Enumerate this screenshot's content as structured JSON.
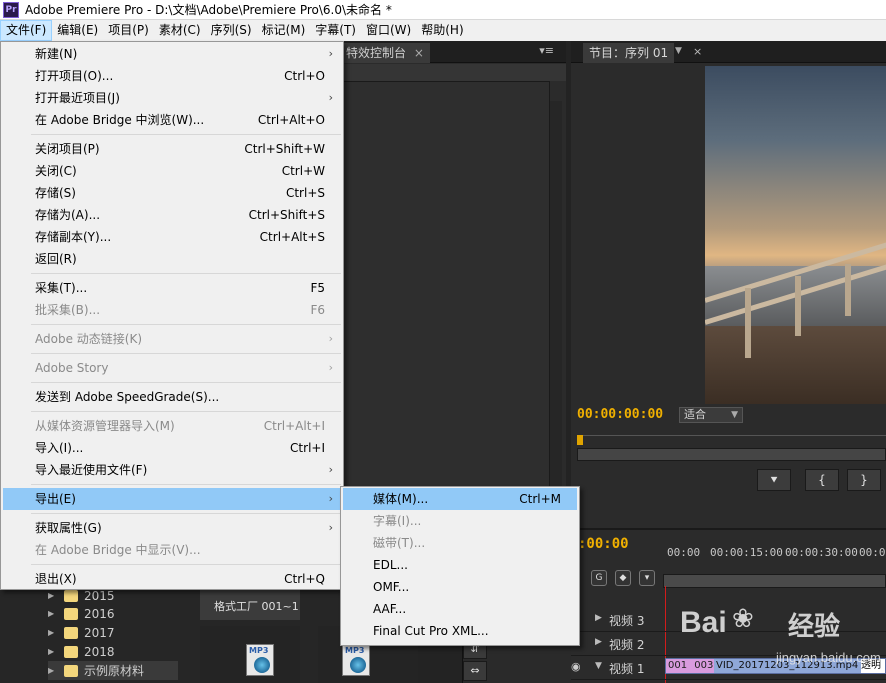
{
  "window": {
    "icon_text": "Pr",
    "title": "Adobe Premiere Pro - D:\\文档\\Adobe\\Premiere Pro\\6.0\\未命名 *"
  },
  "menubar": [
    {
      "label": "文件(F)",
      "active": true
    },
    {
      "label": "编辑(E)"
    },
    {
      "label": "项目(P)"
    },
    {
      "label": "素材(C)"
    },
    {
      "label": "序列(S)"
    },
    {
      "label": "标记(M)"
    },
    {
      "label": "字幕(T)"
    },
    {
      "label": "窗口(W)"
    },
    {
      "label": "帮助(H)"
    }
  ],
  "file_menu": {
    "items": [
      {
        "label": "新建(N)",
        "submenu": true
      },
      {
        "label": "打开项目(O)...",
        "shortcut": "Ctrl+O"
      },
      {
        "label": "打开最近项目(J)",
        "submenu": true
      },
      {
        "label": "在 Adobe Bridge 中浏览(W)...",
        "shortcut": "Ctrl+Alt+O"
      },
      {
        "label": "关闭项目(P)",
        "shortcut": "Ctrl+Shift+W"
      },
      {
        "label": "关闭(C)",
        "shortcut": "Ctrl+W"
      },
      {
        "label": "存储(S)",
        "shortcut": "Ctrl+S"
      },
      {
        "label": "存储为(A)...",
        "shortcut": "Ctrl+Shift+S"
      },
      {
        "label": "存储副本(Y)...",
        "shortcut": "Ctrl+Alt+S"
      },
      {
        "label": "返回(R)"
      },
      {
        "label": "采集(T)...",
        "shortcut": "F5"
      },
      {
        "label": "批采集(B)...",
        "shortcut": "F6",
        "disabled": true
      },
      {
        "label": "Adobe 动态链接(K)",
        "submenu": true,
        "disabled": true
      },
      {
        "label": "Adobe Story",
        "submenu": true,
        "disabled": true
      },
      {
        "label": "发送到 Adobe SpeedGrade(S)..."
      },
      {
        "label": "从媒体资源管理器导入(M)",
        "shortcut": "Ctrl+Alt+I",
        "disabled": true
      },
      {
        "label": "导入(I)...",
        "shortcut": "Ctrl+I"
      },
      {
        "label": "导入最近使用文件(F)",
        "submenu": true
      },
      {
        "label": "导出(E)",
        "submenu": true,
        "highlight": true
      },
      {
        "label": "获取属性(G)",
        "submenu": true
      },
      {
        "label": "在 Adobe Bridge 中显示(V)...",
        "disabled": true
      },
      {
        "label": "退出(X)",
        "shortcut": "Ctrl+Q"
      }
    ]
  },
  "export_submenu": {
    "items": [
      {
        "label": "媒体(M)...",
        "shortcut": "Ctrl+M",
        "highlight": true
      },
      {
        "label": "字幕(I)...",
        "disabled": true
      },
      {
        "label": "磁带(T)...",
        "disabled": true
      },
      {
        "label": "EDL..."
      },
      {
        "label": "OMF..."
      },
      {
        "label": "AAF..."
      },
      {
        "label": "Final Cut Pro XML..."
      }
    ]
  },
  "effect_controls": {
    "tab_label": "特效控制台",
    "tab_close": "×",
    "panel_menu": "▾≡"
  },
  "program_monitor": {
    "tab_label": "节目：序列 01",
    "tab_dropdown": "▼",
    "tab_close": "×",
    "timecode": "00:00:00:00",
    "fit_label": "适合",
    "buttons": [
      "⯆",
      "{",
      "}"
    ]
  },
  "timeline": {
    "timecode": ":00:00",
    "ruler_ticks": [
      "00:00",
      "00:00:15:00",
      "00:00:30:00",
      "00:00"
    ],
    "tracks": [
      {
        "label": "视频 3"
      },
      {
        "label": "视频 2"
      },
      {
        "label": "视频 1"
      }
    ],
    "clip": {
      "prefix": "001",
      "prefix2": "003",
      "name": "VID_20171203_112913.mp4",
      "extra": "透明"
    }
  },
  "project": {
    "folders": [
      {
        "label": "2015"
      },
      {
        "label": "2016"
      },
      {
        "label": "2017"
      },
      {
        "label": "2018"
      },
      {
        "label": "示例原材料",
        "selected": true
      }
    ],
    "thumb_label": "格式工厂 001~1",
    "mp3_label": "MP3"
  },
  "watermark": {
    "brand": "Bai",
    "brand_cn": "经验",
    "url": "jingyan.baidu.com"
  },
  "colors": {
    "accent_highlight": "#91c9f7",
    "timecode": "#f0b000",
    "clip_blue": "#8fa8d8",
    "clip_pink": "#d99bde"
  }
}
